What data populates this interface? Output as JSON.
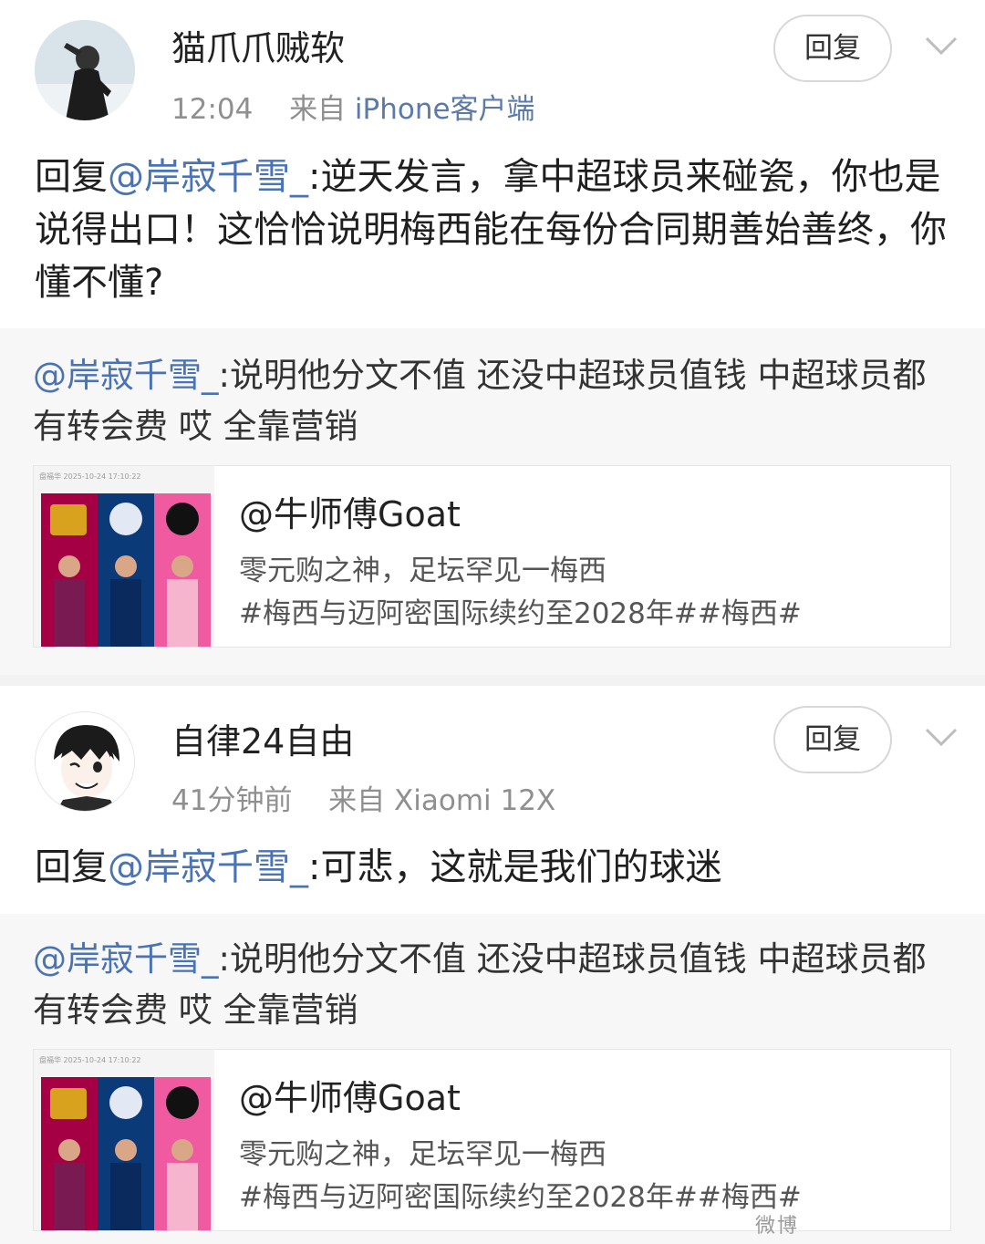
{
  "comments": [
    {
      "username": "猫爪爪贼软",
      "time": "12:04",
      "source_prefix": "来自",
      "source": "iPhone客户端",
      "reply_button": "回复",
      "reply_prefix": "回复",
      "reply_mention": "@岸寂千雪_",
      "reply_body": ":逆天发言，拿中超球员来碰瓷，你也是说得出口！这恰恰说明梅西能在每份合同期善始善终，你懂不懂?",
      "quote": {
        "mention": "@岸寂千雪_",
        "text": ":说明他分文不值  还没中超球员值钱  中超球员都有转会费  哎  全靠营销",
        "card": {
          "thumb_caption": "盘福华    2025-10-24 17:10:22",
          "title": "@牛师傅Goat",
          "line1": "零元购之神，足坛罕见一梅西",
          "line2": "#梅西与迈阿密国际续约至2028年##梅西#"
        }
      }
    },
    {
      "username": "自律24自由",
      "time": "41分钟前",
      "source_prefix": "来自",
      "source": "Xiaomi 12X",
      "reply_button": "回复",
      "reply_prefix": "回复",
      "reply_mention": "@岸寂千雪_",
      "reply_body": ":可悲，这就是我们的球迷",
      "quote": {
        "mention": "@岸寂千雪_",
        "text": ":说明他分文不值  还没中超球员值钱  中超球员都有转会费  哎  全靠营销",
        "card": {
          "thumb_caption": "盘福华    2025-10-24 17:10:22",
          "title": "@牛师傅Goat",
          "line1": "零元购之神，足坛罕见一梅西",
          "line2": "#梅西与迈阿密国际续约至2028年##梅西#"
        }
      }
    }
  ],
  "icons": {
    "chevron": "chevron-down-icon",
    "avatar1": "avatar-silhouette",
    "avatar2": "avatar-anime-boy"
  },
  "colors": {
    "mention": "#4a73b5",
    "meta": "#8f8f8f",
    "barca": "#a50044",
    "psg": "#004170",
    "miami": "#f7b5cd"
  },
  "watermark": "微博"
}
